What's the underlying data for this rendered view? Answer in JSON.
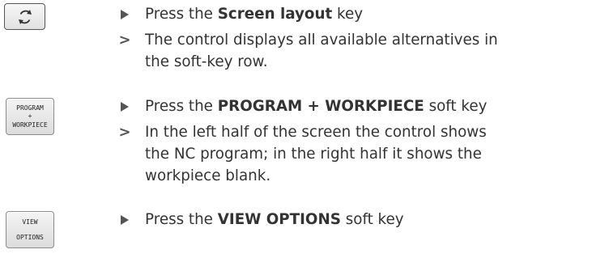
{
  "keys": {
    "screen_layout_icon": "screen-layout-icon",
    "softkey1": {
      "line1": "PROGRAM",
      "line2": "+",
      "line3": "WORKPIECE"
    },
    "softkey2": {
      "line1": "VIEW",
      "line2": "OPTIONS"
    }
  },
  "steps": [
    {
      "type": "action",
      "prefix": "Press the ",
      "bold": "Screen layout",
      "suffix": " key"
    },
    {
      "type": "result",
      "line1": "The control displays all available alternatives in",
      "line2": "the soft-key row."
    },
    {
      "type": "action",
      "prefix": "Press the ",
      "bold": "PROGRAM + WORKPIECE",
      "suffix": " soft key"
    },
    {
      "type": "result",
      "line1": "In the left half of the screen the control shows",
      "line2": "the NC program; in the right half it shows the",
      "line3": "workpiece blank."
    },
    {
      "type": "action",
      "prefix": "Press the ",
      "bold": "VIEW OPTIONS",
      "suffix": " soft key"
    }
  ],
  "colors": {
    "text": "#333333",
    "marker": "#555555",
    "key_border": "#8c8c8c"
  }
}
